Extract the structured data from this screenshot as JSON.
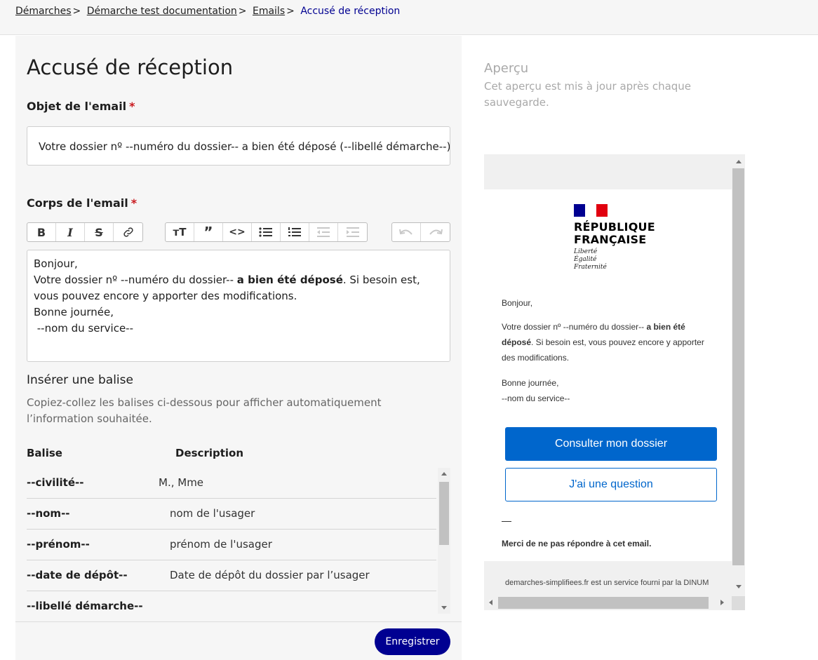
{
  "breadcrumb": {
    "items": [
      "Démarches",
      "Démarche test documentation",
      "Emails"
    ],
    "current": "Accusé de réception",
    "separator": ">"
  },
  "page": {
    "title": "Accusé de réception"
  },
  "subject": {
    "label": "Objet de l'email",
    "required_mark": "*",
    "value": "Votre dossier nº --numéro du dossier-- a bien été déposé (--libellé démarche--)"
  },
  "body": {
    "label": "Corps de l'email",
    "required_mark": "*",
    "line1": "Bonjour,",
    "line2_before": "Votre dossier nº --numéro du dossier-- ",
    "line2_bold": "a bien été déposé",
    "line2_after": ". Si besoin est, vous pouvez encore y apporter des modifications.",
    "line3": "Bonne journée,",
    "line4": " --nom du service--"
  },
  "toolbar": {
    "icons": [
      "bold-icon",
      "italic-icon",
      "strikethrough-icon",
      "link-icon",
      "heading-icon",
      "quote-icon",
      "code-icon",
      "bullet-list-icon",
      "numbered-list-icon",
      "outdent-icon",
      "indent-icon",
      "undo-icon",
      "redo-icon"
    ]
  },
  "tags": {
    "title": "Insérer une balise",
    "help": "Copiez-collez les balises ci-dessous pour afficher automatiquement l’information souhaitée.",
    "col_tag": "Balise",
    "col_desc": "Description",
    "rows": [
      {
        "tag": "--civilité--",
        "desc": "M., Mme"
      },
      {
        "tag": "--nom--",
        "desc": "nom de l'usager"
      },
      {
        "tag": "--prénom--",
        "desc": "prénom de l'usager"
      },
      {
        "tag": "--date de dépôt--",
        "desc": "Date de dépôt du dossier par l’usager"
      },
      {
        "tag": "--libellé démarche--",
        "desc": ""
      }
    ]
  },
  "actions": {
    "save": "Enregistrer"
  },
  "preview": {
    "title": "Aperçu",
    "help": "Cet aperçu est mis à jour après chaque sauvegarde.",
    "logo_line1": "RÉPUBLIQUE",
    "logo_line2": "FRANÇAISE",
    "motto1": "Liberté",
    "motto2": "Égalité",
    "motto3": "Fraternité",
    "greeting": "Bonjour,",
    "p_before": "Votre dossier nº --numéro du dossier-- ",
    "p_bold": "a bien été déposé",
    "p_after": ". Si besoin est, vous pouvez encore y apporter des modifications.",
    "closing1": "Bonne journée,",
    "closing2": "--nom du service--",
    "btn_primary": "Consulter mon dossier",
    "btn_secondary": "J'ai une question",
    "noreply": "Merci de ne pas répondre à cet email.",
    "footer": "demarches-simplifiees.fr est un service fourni par la DINUM"
  },
  "colors": {
    "accent": "#000091",
    "required": "#c9191e",
    "mail_blue": "#0066cc",
    "flag_blue": "#000091",
    "flag_red": "#e1000f"
  }
}
